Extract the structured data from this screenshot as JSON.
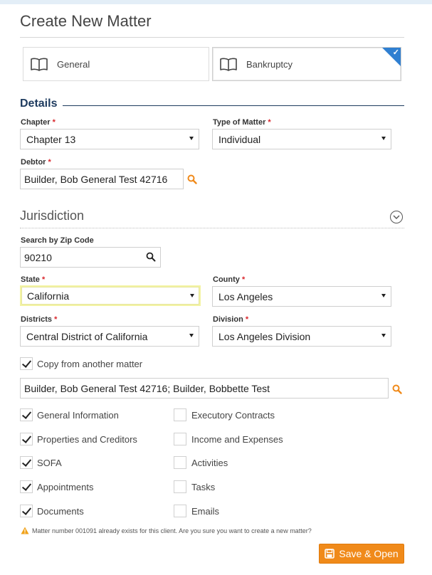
{
  "page": {
    "title": "Create New Matter"
  },
  "matter_types": {
    "general": {
      "label": "General",
      "icon": "book-icon",
      "selected": false
    },
    "bankruptcy": {
      "label": "Bankruptcy",
      "icon": "book-icon",
      "selected": true
    }
  },
  "details": {
    "title": "Details",
    "chapter": {
      "label": "Chapter",
      "required": "*",
      "value": "Chapter 13"
    },
    "type_of_matter": {
      "label": "Type of Matter",
      "required": "*",
      "value": "Individual"
    },
    "debtor": {
      "label": "Debtor",
      "required": "*",
      "value": "Builder, Bob General Test 42716"
    }
  },
  "jurisdiction": {
    "title": "Jurisdiction",
    "zip": {
      "label": "Search by Zip Code",
      "value": "90210"
    },
    "state": {
      "label": "State",
      "required": "*",
      "value": "California"
    },
    "county": {
      "label": "County",
      "required": "*",
      "value": "Los Angeles"
    },
    "districts": {
      "label": "Districts",
      "required": "*",
      "value": "Central District of California"
    },
    "division": {
      "label": "Division",
      "required": "*",
      "value": "Los Angeles Division"
    }
  },
  "copy": {
    "label": "Copy from another matter",
    "checked": true,
    "matter_value": "Builder, Bob General Test 42716; Builder, Bobbette Test",
    "options_left": [
      {
        "label": "General Information",
        "checked": true
      },
      {
        "label": "Properties and Creditors",
        "checked": true
      },
      {
        "label": "SOFA",
        "checked": true
      },
      {
        "label": "Appointments",
        "checked": true
      },
      {
        "label": "Documents",
        "checked": true
      }
    ],
    "options_right": [
      {
        "label": "Executory Contracts",
        "checked": false
      },
      {
        "label": "Income and Expenses",
        "checked": false
      },
      {
        "label": "Activities",
        "checked": false
      },
      {
        "label": "Tasks",
        "checked": false
      },
      {
        "label": "Emails",
        "checked": false
      }
    ]
  },
  "warning": {
    "text": "Matter number 001091 already exists for this client. Are you sure you want to create a new matter?"
  },
  "actions": {
    "save_open_label": "Save & Open"
  },
  "colors": {
    "accent_orange": "#f08a1a",
    "selected_blue": "#2f7fd1",
    "heading_navy": "#1d3a5e",
    "required_red": "#d9262c"
  }
}
